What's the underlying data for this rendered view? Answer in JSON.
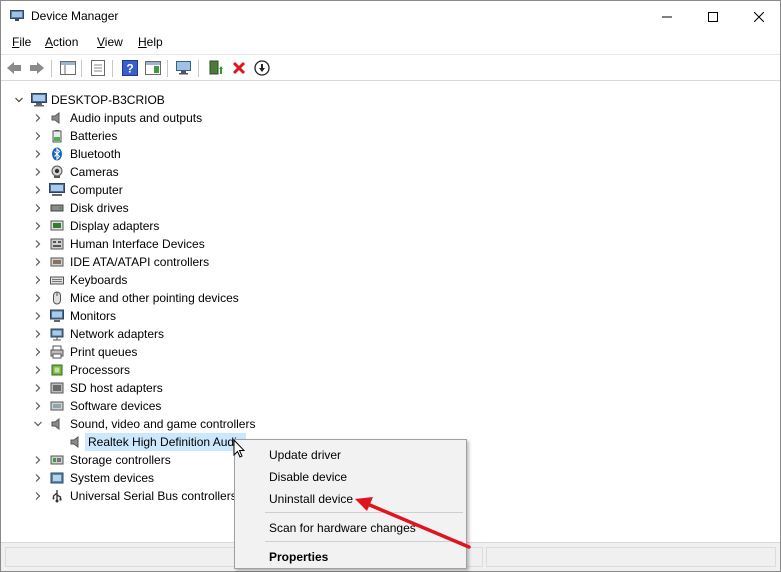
{
  "window": {
    "title": "Device Manager",
    "controls": [
      "minimize",
      "maximize",
      "close"
    ]
  },
  "menubar": {
    "file": {
      "accel": "F",
      "rest": "ile"
    },
    "action": {
      "accel": "A",
      "rest": "ction"
    },
    "view": {
      "accel": "V",
      "rest": "iew"
    },
    "help": {
      "accel": "H",
      "rest": "elp"
    }
  },
  "toolbar": {
    "buttons": [
      "back-icon",
      "forward-icon",
      "show-hide-tree-icon",
      "properties-icon",
      "help-icon",
      "action-pane-icon",
      "scan-hardware-icon",
      "update-driver-icon",
      "uninstall-icon",
      "disable-icon"
    ]
  },
  "tree": {
    "root": "DESKTOP-B3CRIOB",
    "categories": [
      {
        "label": "Audio inputs and outputs",
        "icon": "speaker-icon"
      },
      {
        "label": "Batteries",
        "icon": "battery-icon"
      },
      {
        "label": "Bluetooth",
        "icon": "bluetooth-icon"
      },
      {
        "label": "Cameras",
        "icon": "camera-icon"
      },
      {
        "label": "Computer",
        "icon": "computer-icon"
      },
      {
        "label": "Disk drives",
        "icon": "disk-icon"
      },
      {
        "label": "Display adapters",
        "icon": "display-adapter-icon"
      },
      {
        "label": "Human Interface Devices",
        "icon": "hid-icon"
      },
      {
        "label": "IDE ATA/ATAPI controllers",
        "icon": "ide-icon"
      },
      {
        "label": "Keyboards",
        "icon": "keyboard-icon"
      },
      {
        "label": "Mice and other pointing devices",
        "icon": "mouse-icon"
      },
      {
        "label": "Monitors",
        "icon": "monitor-icon"
      },
      {
        "label": "Network adapters",
        "icon": "network-icon"
      },
      {
        "label": "Print queues",
        "icon": "printer-icon"
      },
      {
        "label": "Processors",
        "icon": "processor-icon"
      },
      {
        "label": "SD host adapters",
        "icon": "sd-icon"
      },
      {
        "label": "Software devices",
        "icon": "software-icon"
      },
      {
        "label": "Sound, video and game controllers",
        "icon": "speaker-icon",
        "expanded": true
      },
      {
        "label": "Storage controllers",
        "icon": "storage-icon"
      },
      {
        "label": "System devices",
        "icon": "system-icon"
      },
      {
        "label": "Universal Serial Bus controllers",
        "icon": "usb-icon"
      }
    ],
    "selected_child": "Realtek High Definition Audio"
  },
  "context_menu": {
    "items": [
      "Update driver",
      "Disable device",
      "Uninstall device",
      "Scan for hardware changes",
      "Properties"
    ]
  },
  "colors": {
    "selection": "#cce8ff",
    "annotation_arrow": "#e0141e",
    "menu_bg": "#f2f2f2"
  }
}
